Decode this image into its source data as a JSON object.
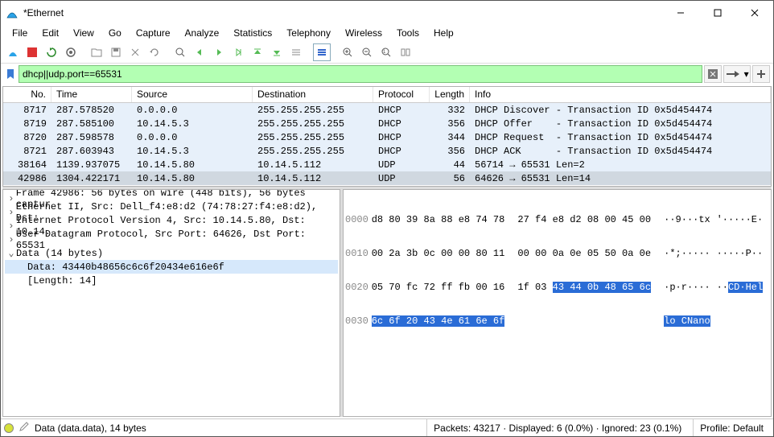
{
  "window": {
    "title": "*Ethernet"
  },
  "menu": [
    "File",
    "Edit",
    "View",
    "Go",
    "Capture",
    "Analyze",
    "Statistics",
    "Telephony",
    "Wireless",
    "Tools",
    "Help"
  ],
  "filter": {
    "value": "dhcp||udp.port==65531"
  },
  "packet_columns": {
    "no": "No.",
    "time": "Time",
    "source": "Source",
    "dest": "Destination",
    "proto": "Protocol",
    "len": "Length",
    "info": "Info"
  },
  "packets": [
    {
      "no": "8717",
      "time": "287.578520",
      "src": "0.0.0.0",
      "dst": "255.255.255.255",
      "proto": "DHCP",
      "len": "332",
      "info": "DHCP Discover - Transaction ID 0x5d454474",
      "cls": "row-dhcp"
    },
    {
      "no": "8719",
      "time": "287.585100",
      "src": "10.14.5.3",
      "dst": "255.255.255.255",
      "proto": "DHCP",
      "len": "356",
      "info": "DHCP Offer    - Transaction ID 0x5d454474",
      "cls": "row-dhcp"
    },
    {
      "no": "8720",
      "time": "287.598578",
      "src": "0.0.0.0",
      "dst": "255.255.255.255",
      "proto": "DHCP",
      "len": "344",
      "info": "DHCP Request  - Transaction ID 0x5d454474",
      "cls": "row-dhcp"
    },
    {
      "no": "8721",
      "time": "287.603943",
      "src": "10.14.5.3",
      "dst": "255.255.255.255",
      "proto": "DHCP",
      "len": "356",
      "info": "DHCP ACK      - Transaction ID 0x5d454474",
      "cls": "row-dhcp"
    },
    {
      "no": "38164",
      "time": "1139.937075",
      "src": "10.14.5.80",
      "dst": "10.14.5.112",
      "proto": "UDP",
      "len": "44",
      "info": "56714 → 65531 Len=2",
      "cls": "row-udp"
    },
    {
      "no": "42986",
      "time": "1304.422171",
      "src": "10.14.5.80",
      "dst": "10.14.5.112",
      "proto": "UDP",
      "len": "56",
      "info": "64626 → 65531 Len=14",
      "cls": "row-sel"
    }
  ],
  "details": {
    "frame": "Frame 42986: 56 bytes on wire (448 bits), 56 bytes captur",
    "eth": "Ethernet II, Src: Dell_f4:e8:d2 (74:78:27:f4:e8:d2), Dst:",
    "ip": "Internet Protocol Version 4, Src: 10.14.5.80, Dst: 10.14.",
    "udp": "User Datagram Protocol, Src Port: 64626, Dst Port: 65531",
    "data": "Data (14 bytes)",
    "data_payload": "Data: 43440b48656c6c6f20434e616e6f",
    "data_len": "[Length: 14]"
  },
  "hex": {
    "lines": [
      {
        "off": "0000",
        "b1": "d8 80 39 8a 88 e8 74 78",
        "b2": "27 f4 e8 d2 08 00 45 00",
        "a1": "··9···tx",
        "a2": "'·····E·"
      },
      {
        "off": "0010",
        "b1": "00 2a 3b 0c 00 00 80 11",
        "b2": "00 00 0a 0e 05 50 0a 0e",
        "a1": "·*;·····",
        "a2": "·····P··"
      },
      {
        "off": "0020",
        "b1": "05 70 fc 72 ff fb 00 16",
        "b2p": "1f 03 ",
        "b2h": "43 44 0b 48 65 6c",
        "a1": "·p·r····",
        "a2p": "··",
        "a2h": "CD·Hel"
      },
      {
        "off": "0030",
        "b1h": "6c 6f 20 43 4e 61 6e 6f",
        "a1h": "lo CNano"
      }
    ]
  },
  "status": {
    "field": "Data (data.data), 14 bytes",
    "packets": "Packets: 43217 · Displayed: 6 (0.0%) · Ignored: 23 (0.1%)",
    "profile": "Profile: Default"
  }
}
